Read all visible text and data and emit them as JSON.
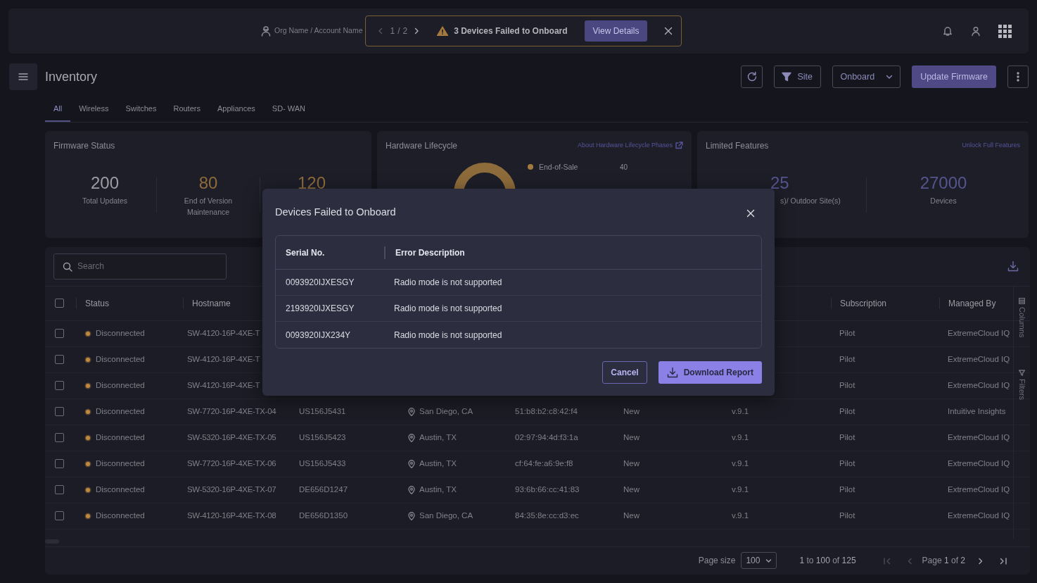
{
  "topbar": {
    "org": "Org Name / Account Name",
    "pager": {
      "current": "1",
      "separator": "/",
      "total": "2",
      "prev_disabled": true,
      "next_disabled": false
    },
    "alert": "3 Devices Failed to Onboard",
    "alert_action": "View Details"
  },
  "page": {
    "title": "Inventory",
    "actions": {
      "site": "Site",
      "onboard": "Onboard",
      "update": "Update Firmware"
    }
  },
  "tabs": [
    {
      "label": "All",
      "selected": true
    },
    {
      "label": "Wireless",
      "selected": false
    },
    {
      "label": "Switches",
      "selected": false
    },
    {
      "label": "Routers",
      "selected": false
    },
    {
      "label": "Appliances",
      "selected": false
    },
    {
      "label": "SD- WAN",
      "selected": false
    }
  ],
  "cards": [
    {
      "kind": "firmware",
      "title": "Firmware Status",
      "stats": [
        {
          "value": "200",
          "label": "Total Updates",
          "color": "#9c9ca5"
        },
        {
          "value": "80",
          "label": "End of Version Maintenance",
          "color": "#8d6b3a"
        },
        {
          "value": "120",
          "color": "#8d6b3a"
        }
      ]
    },
    {
      "kind": "lifecycle",
      "title": "Hardware Lifecycle",
      "link": "About Hardware Lifecycle Phases",
      "legend": [
        {
          "label": "End-of-Sale",
          "value": "40",
          "color": "#a47a3e"
        }
      ]
    },
    {
      "kind": "features",
      "title": "Limited Features",
      "link": "Unlock Full Features",
      "stats": [
        {
          "value": "25",
          "label": "s)/ Outdoor Site(s)",
          "color": "#55548e"
        },
        {
          "value": "27000",
          "label": "Devices",
          "color": "#55548e"
        }
      ]
    }
  ],
  "table": {
    "search": {
      "placeholder": "Search"
    },
    "header_checked": false,
    "columns": [
      "Status",
      "Hostname",
      "Subscription",
      "Managed By"
    ],
    "rows": [
      {
        "kind": "partial",
        "checked": false,
        "color": "#c08a3e",
        "cells": [
          "Disconnected",
          "SW-4120-16P-4XE-T",
          "Pilot",
          "ExtremeCloud IQ"
        ]
      },
      {
        "kind": "partial",
        "checked": false,
        "color": "#c08a3e",
        "cells": [
          "Disconnected",
          "SW-4120-16P-4XE-T",
          "Pilot",
          "ExtremeCloud IQ"
        ]
      },
      {
        "kind": "partial",
        "checked": false,
        "color": "#c08a3e",
        "cells": [
          "Disconnected",
          "SW-4120-16P-4XE-T",
          "Pilot",
          "ExtremeCloud IQ"
        ]
      },
      {
        "kind": "full",
        "checked": false,
        "color": "#c08a3e",
        "cells": [
          "Disconnected",
          "SW-7720-16P-4XE-TX-04",
          "US156J5431",
          "San Diego, CA",
          "51:b8:b2:c8:42:f4",
          "New",
          "v.9.1",
          "Pilot",
          "Intuitive Insights"
        ]
      },
      {
        "kind": "full",
        "checked": false,
        "color": "#c08a3e",
        "cells": [
          "Disconnected",
          "SW-5320-16P-4XE-TX-05",
          "US156J5423",
          "Austin, TX",
          "02:97:94:4d:f3:1a",
          "New",
          "v.9.1",
          "Pilot",
          "ExtremeCloud IQ"
        ]
      },
      {
        "kind": "full",
        "checked": false,
        "color": "#c08a3e",
        "cells": [
          "Disconnected",
          "SW-7720-16P-4XE-TX-06",
          "US156J5433",
          "Austin, TX",
          "cf:64:fe:a6:9e:f8",
          "New",
          "v.9.1",
          "Pilot",
          "ExtremeCloud IQ"
        ]
      },
      {
        "kind": "full",
        "checked": false,
        "color": "#c08a3e",
        "cells": [
          "Disconnected",
          "SW-5320-16P-4XE-TX-07",
          "DE656D1247",
          "Austin, TX",
          "93:6b:66:cc:41:83",
          "New",
          "v.9.1",
          "Pilot",
          "ExtremeCloud IQ"
        ]
      },
      {
        "kind": "full",
        "checked": false,
        "color": "#c08a3e",
        "cells": [
          "Disconnected",
          "SW-4120-16P-4XE-TX-08",
          "DE656D1350",
          "San Diego, CA",
          "84:35:8e:cc:d3:ec",
          "New",
          "v.9.1",
          "Pilot",
          "ExtremeCloud IQ"
        ]
      }
    ],
    "side_tabs": [
      "Columns",
      "Filters"
    ],
    "pagination": {
      "page_size_label": "Page size",
      "page_size": "100",
      "range": "**1** to **100** of **125**",
      "page": "Page **1** of **2**",
      "first_disabled": true,
      "prev_disabled": true,
      "next_disabled": false,
      "last_disabled": false
    }
  },
  "modal": {
    "title": "Devices Failed to Onboard",
    "columns": [
      "Serial No.",
      "Error Description"
    ],
    "rows": [
      [
        "0093920IJXESGY",
        "Radio mode is not supported"
      ],
      [
        "2193920IJXESGY",
        "Radio mode is not supported"
      ],
      [
        "0093920IJX234Y",
        "Radio mode is not supported"
      ]
    ],
    "buttons": {
      "cancel": "Cancel",
      "primary": "Download Report"
    }
  }
}
